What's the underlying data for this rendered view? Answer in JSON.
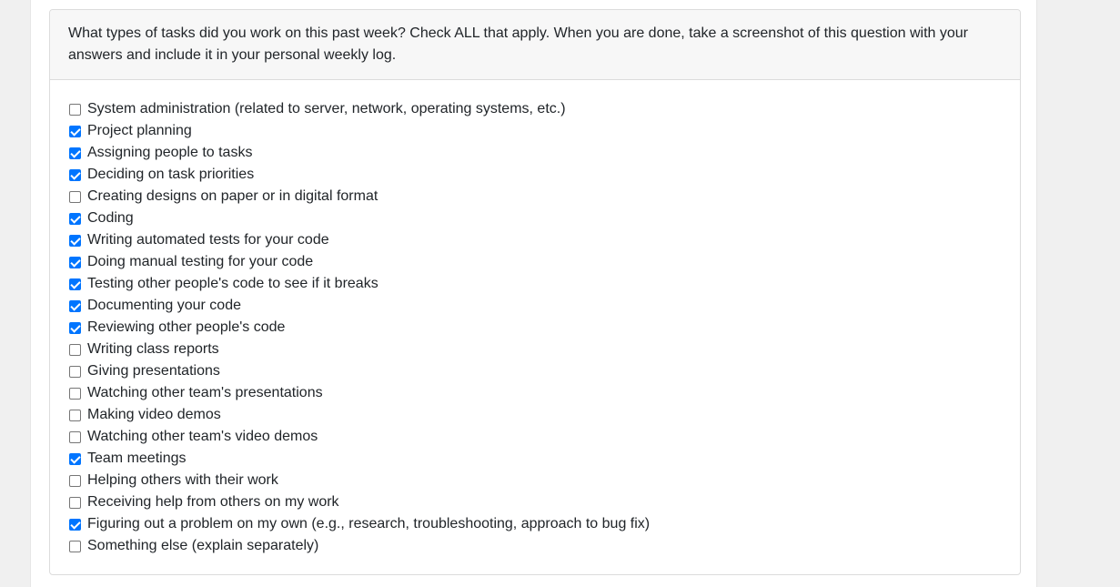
{
  "question": {
    "text": "What types of tasks did you work on this past week? Check ALL that apply. When you are done, take a screenshot of this question with your answers and include it in your personal weekly log."
  },
  "options": [
    {
      "label": "System administration (related to server, network, operating systems, etc.)",
      "checked": false
    },
    {
      "label": "Project planning",
      "checked": true
    },
    {
      "label": "Assigning people to tasks",
      "checked": true
    },
    {
      "label": "Deciding on task priorities",
      "checked": true
    },
    {
      "label": "Creating designs on paper or in digital format",
      "checked": false
    },
    {
      "label": "Coding",
      "checked": true
    },
    {
      "label": "Writing automated tests for your code",
      "checked": true
    },
    {
      "label": "Doing manual testing for your code",
      "checked": true
    },
    {
      "label": "Testing other people's code to see if it breaks",
      "checked": true
    },
    {
      "label": "Documenting your code",
      "checked": true
    },
    {
      "label": "Reviewing other people's code",
      "checked": true
    },
    {
      "label": "Writing class reports",
      "checked": false
    },
    {
      "label": "Giving presentations",
      "checked": false
    },
    {
      "label": "Watching other team's presentations",
      "checked": false
    },
    {
      "label": "Making video demos",
      "checked": false
    },
    {
      "label": "Watching other team's video demos",
      "checked": false
    },
    {
      "label": "Team meetings",
      "checked": true
    },
    {
      "label": "Helping others with their work",
      "checked": false
    },
    {
      "label": "Receiving help from others on my work",
      "checked": false
    },
    {
      "label": "Figuring out a problem on my own (e.g., research, troubleshooting, approach to bug fix)",
      "checked": true
    },
    {
      "label": "Something else (explain separately)",
      "checked": false
    }
  ],
  "colors": {
    "accent": "#0075ff",
    "header_bg": "#f7f7f7",
    "text": "#212529"
  }
}
